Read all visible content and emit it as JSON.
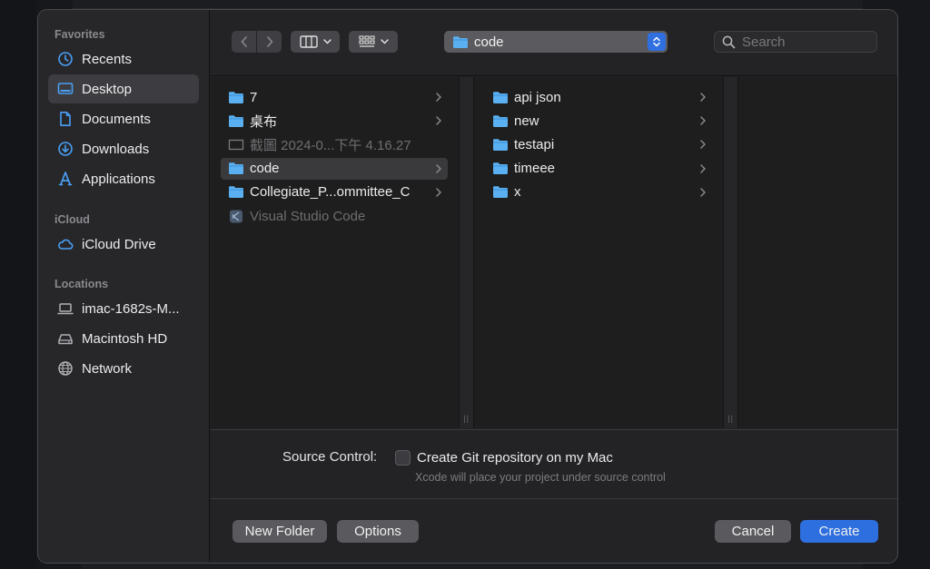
{
  "sidebar": {
    "favorites_title": "Favorites",
    "icloud_title": "iCloud",
    "locations_title": "Locations",
    "favorites": [
      {
        "label": "Recents",
        "icon": "clock-icon"
      },
      {
        "label": "Desktop",
        "icon": "desktop-icon"
      },
      {
        "label": "Documents",
        "icon": "document-icon"
      },
      {
        "label": "Downloads",
        "icon": "download-icon"
      },
      {
        "label": "Applications",
        "icon": "applications-icon"
      }
    ],
    "icloud": [
      {
        "label": "iCloud Drive",
        "icon": "cloud-icon"
      }
    ],
    "locations": [
      {
        "label": "imac-1682s-M...",
        "icon": "laptop-icon"
      },
      {
        "label": "Macintosh HD",
        "icon": "drive-icon"
      },
      {
        "label": "Network",
        "icon": "globe-icon"
      }
    ]
  },
  "toolbar": {
    "current_folder": "code",
    "search_placeholder": "Search"
  },
  "browser": {
    "column1": [
      {
        "name": "7",
        "type": "folder"
      },
      {
        "name": "桌布",
        "type": "folder"
      },
      {
        "name": "截圖 2024-0...下午 4.16.27",
        "type": "file-disabled"
      },
      {
        "name": "code",
        "type": "folder",
        "selected": true
      },
      {
        "name": "Collegiate_P...ommittee_C",
        "type": "folder"
      },
      {
        "name": "Visual Studio Code",
        "type": "app-disabled"
      }
    ],
    "column2": [
      {
        "name": "api json",
        "type": "folder"
      },
      {
        "name": "new",
        "type": "folder"
      },
      {
        "name": "testapi",
        "type": "folder"
      },
      {
        "name": "timeee",
        "type": "folder"
      },
      {
        "name": "x",
        "type": "folder"
      }
    ]
  },
  "source_control": {
    "label": "Source Control:",
    "checkbox_label": "Create Git repository on my Mac",
    "checked": false,
    "help_text": "Xcode will place your project under source control"
  },
  "footer": {
    "new_folder": "New Folder",
    "options": "Options",
    "cancel": "Cancel",
    "create": "Create"
  },
  "colors": {
    "accent": "#2e6fe0",
    "folder": "#5ab0f0",
    "selection": "#3a3a3d"
  }
}
